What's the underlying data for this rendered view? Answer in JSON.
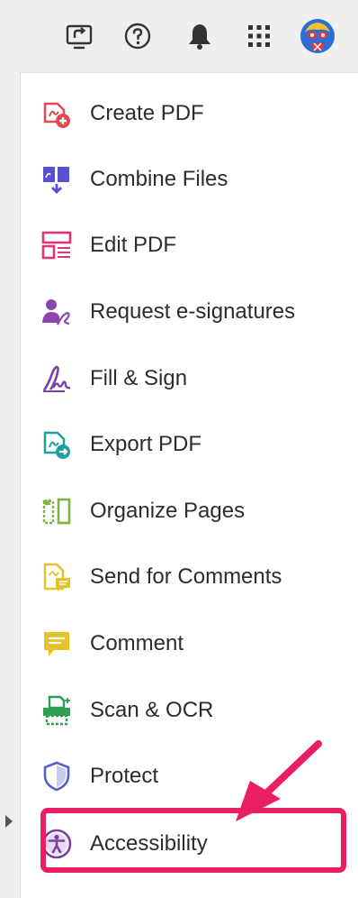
{
  "colors": {
    "highlight": "#e91e63",
    "create_pdf": "#e34850",
    "combine_files": "#5a4fcf",
    "edit_pdf": "#e0347a",
    "request_esign": "#8e44ad",
    "fill_sign": "#7b3fa0",
    "export_pdf": "#1ea0a0",
    "organize_pages": "#7cb342",
    "send_comments": "#e6c229",
    "comment": "#e6c229",
    "scan_ocr": "#2e9e4f",
    "protect": "#5a5fc7",
    "accessibility": "#7b3fa0"
  },
  "topbar": {
    "icons": [
      "share-screen-icon",
      "help-icon",
      "bell-icon",
      "apps-grid-icon",
      "avatar"
    ]
  },
  "tools": [
    {
      "label": "Create PDF",
      "icon": "create-pdf-icon"
    },
    {
      "label": "Combine Files",
      "icon": "combine-files-icon"
    },
    {
      "label": "Edit PDF",
      "icon": "edit-pdf-icon"
    },
    {
      "label": "Request e-signatures",
      "icon": "request-esign-icon"
    },
    {
      "label": "Fill & Sign",
      "icon": "fill-sign-icon"
    },
    {
      "label": "Export PDF",
      "icon": "export-pdf-icon"
    },
    {
      "label": "Organize Pages",
      "icon": "organize-pages-icon"
    },
    {
      "label": "Send for Comments",
      "icon": "send-comments-icon"
    },
    {
      "label": "Comment",
      "icon": "comment-icon"
    },
    {
      "label": "Scan & OCR",
      "icon": "scan-ocr-icon"
    },
    {
      "label": "Protect",
      "icon": "protect-icon"
    },
    {
      "label": "Accessibility",
      "icon": "accessibility-icon"
    }
  ]
}
